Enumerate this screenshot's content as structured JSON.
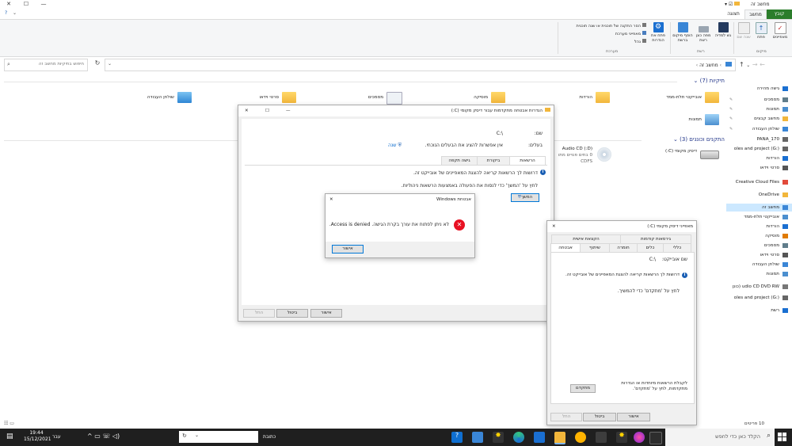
{
  "window": {
    "title": "מחשב זה",
    "qat_label": "קובץ"
  },
  "ribbon": {
    "tabs": [
      "קובץ",
      "מחשב",
      "תצוגה"
    ],
    "file_tab": "קובץ",
    "computer_tab": "מחשב",
    "view_tab": "תצוגה",
    "location": {
      "label": "מיקום",
      "properties": "מאפיינים",
      "open": "פתח",
      "rename": "שנה שם"
    },
    "network": {
      "label": "רשת",
      "access_media": "גש למדיה",
      "map_drive": "מפה כונן רשת",
      "add_location": "הוסף מיקום ברשת"
    },
    "system": {
      "label": "מערכת",
      "open_settings": "פתח את הגדרות",
      "uninstall": "הסר התקנה של תוכנית או שנה תוכנית",
      "sys_props": "מאפייני מערכת",
      "manage": "נהל"
    }
  },
  "address": {
    "path": "מחשב זה",
    "search_placeholder": "חיפוש בתיקיות מחשב זה"
  },
  "nav": {
    "items": [
      {
        "label": "גישה מהירה",
        "pin": false
      },
      {
        "label": "מסמכים",
        "pin": true
      },
      {
        "label": "תמונות",
        "pin": true
      },
      {
        "label": "מחשב קבצים",
        "pin": true
      },
      {
        "label": "שולחן העבודה",
        "pin": true
      },
      {
        "label": "PANA_170",
        "pin": false
      },
      {
        "label": "oles and project (G:)",
        "pin": false
      },
      {
        "label": "הורדות",
        "pin": false
      },
      {
        "label": "סרטי וידאו",
        "pin": false
      },
      {
        "label": "Creative Cloud Files",
        "pin": false
      },
      {
        "label": "OneDrive",
        "pin": false
      },
      {
        "label": "מחשב זה",
        "pin": false
      },
      {
        "label": "אובייקטי תלת-ממד",
        "pin": false
      },
      {
        "label": "הורדות",
        "pin": false
      },
      {
        "label": "מוסיקה",
        "pin": false
      },
      {
        "label": "מסמכים",
        "pin": false
      },
      {
        "label": "סרטי וידאו",
        "pin": false
      },
      {
        "label": "שולחן העבודה",
        "pin": false
      },
      {
        "label": "תמונות",
        "pin": false
      },
      {
        "label": "udio CD DVD RW (‫כונן",
        "pin": false
      },
      {
        "label": "oles and project (G:)",
        "pin": false
      },
      {
        "label": "רשת",
        "pin": false
      }
    ]
  },
  "content": {
    "folders_header": "תיקיות (7)",
    "folders": [
      "אובייקטי תלת-ממד",
      "הורדות",
      "מוסיקה",
      "מסמכים",
      "סרטי וידאו",
      "שולחן העבודה",
      "תמונות"
    ],
    "drives_header": "התקנים וכוננים (3)",
    "drives": [
      {
        "name": "דיסק מקומי (C:)",
        "sub": ""
      },
      {
        "name": "(D:) Audio CD",
        "sub": "0 בתים פנויים מתו",
        "sub2": "CDFS"
      }
    ],
    "status": "10 פריטים"
  },
  "sec_dialog": {
    "title": "הגדרות אבטחה מתקדמות עבור דיסק מקומי (C:)",
    "name_label": "שם:",
    "name_value": "C:\\",
    "owner_label": "בעלים:",
    "owner_value": "אין אפשרות להציג את הבעלים הנוכחי.",
    "change_link": "שנה",
    "tabs": [
      "הרשאות",
      "ביקורת",
      "גישה תקפה"
    ],
    "info1": "דרושות לך הרשאות קריאה להצגת המאפיינים של אובייקט זה.",
    "info2": "לחץ על 'המשך' כדי לנסות את הפעולה באמצעות הרשאות ניהוליות.",
    "continue_btn": "המשך",
    "ok_btn": "אישור",
    "cancel_btn": "ביטול",
    "apply_btn": "החל"
  },
  "props_dialog": {
    "title": "מאפייני דיסק מקומי (C:)",
    "tabs_row1": [
      "גירסאות קודמות",
      "הקצאת אישית"
    ],
    "tabs_row2": [
      "כללי",
      "כלים",
      "חומרה",
      "שיתוף",
      "אבטחה"
    ],
    "object_label": "שם אובייקט:",
    "object_value": "C:\\",
    "info1": "דרושות לך הרשאות קריאה להצגת המאפיינים של אובייקט זה.",
    "info2": "לחץ על 'מתקדם' כדי להמשיך.",
    "adv_text": "לקבלת הרשאות מיוחדות או הגדרות מתקדמות, לחץ על 'מתקדם'.",
    "advanced_btn": "מתקדם",
    "ok_btn": "אישור",
    "cancel_btn": "ביטול",
    "apply_btn": "החל"
  },
  "error_dialog": {
    "title": "אבטחת Windows",
    "message": "לא ניתן לפתוח את עורך בקרת הגישה. Access is denied.",
    "ok_btn": "אישור"
  },
  "taskbar": {
    "search_placeholder": "הקלד כאן כדי לחפש",
    "address_label": "כתובת",
    "time": "19:44",
    "date": "15/12/2021",
    "lang": "עבר"
  },
  "colors": {
    "accent": "#0078d7",
    "taskbar": "#1f1f1f",
    "ribbon": "#f5f6f7",
    "file_tab": "#2b7d2b"
  }
}
